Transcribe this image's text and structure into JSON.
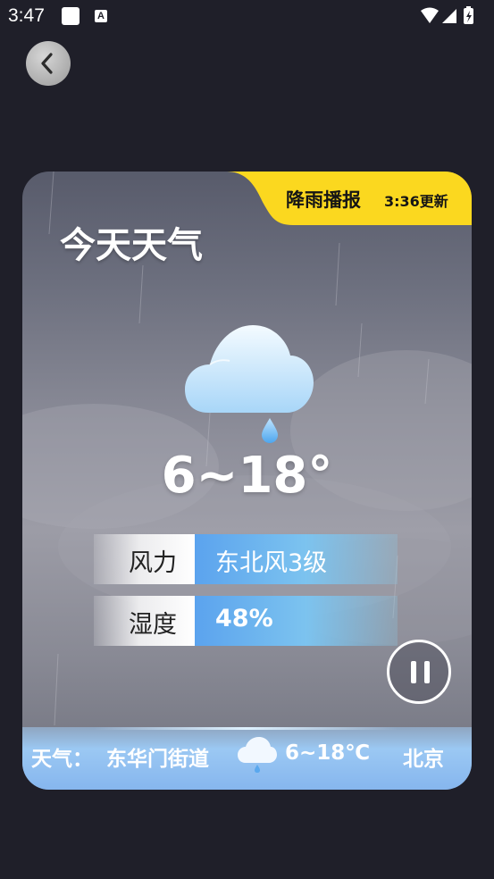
{
  "status_bar": {
    "time": "3:47",
    "icons": [
      "app-square-icon",
      "font-a-icon",
      "wifi-icon",
      "signal-icon",
      "battery-charging-icon"
    ]
  },
  "nav": {
    "back_icon": "chevron-left-icon"
  },
  "card": {
    "title": "今天天气",
    "tag": {
      "label": "降雨播报",
      "update_time": "3:36更新"
    },
    "weather_icon": "cloud-rain-drop-icon",
    "temperature_range": "6~18°",
    "details": [
      {
        "label": "风力",
        "value": "东北风3级"
      },
      {
        "label": "湿度",
        "value": "48%"
      }
    ],
    "controls": {
      "pause_icon": "pause-icon"
    }
  },
  "ticker": {
    "prefix": "天气：",
    "location": "东华门街道",
    "icon": "cloud-rain-icon",
    "temperature": "6~18℃",
    "next_city": "北京"
  },
  "colors": {
    "background": "#1f1f29",
    "tag_yellow": "#fbd81f",
    "value_blue": "#5ba3ee",
    "ticker_blue": "#86b6ee"
  }
}
